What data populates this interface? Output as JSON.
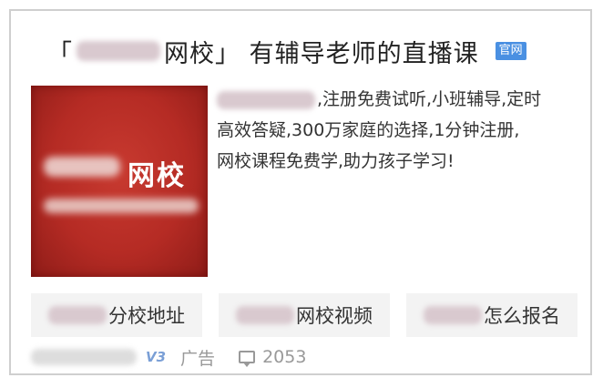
{
  "result": {
    "title_open_bracket": "「",
    "title_middle": "网校」 有辅导老师的直播课",
    "official_badge": "官网",
    "logo_text": "网校",
    "description_lines": [
      ",注册免费试听,小班辅导,定时",
      "高效答疑,300万家庭的选择,1分钟注册,",
      "网校课程免费学,助力孩子学习!"
    ],
    "sitelinks": [
      {
        "label": "分校地址"
      },
      {
        "label": "网校视频"
      },
      {
        "label": "怎么报名"
      }
    ],
    "footer": {
      "v_badge": "V3",
      "ad_label": "广告",
      "comment_count": "2053"
    }
  },
  "colors": {
    "logo_red": "#b52b24",
    "badge_blue": "#4a90e2",
    "v_badge_blue": "#7a9fd6"
  },
  "icons": {
    "verification": "v3-badge-icon",
    "comments": "comment-icon"
  }
}
